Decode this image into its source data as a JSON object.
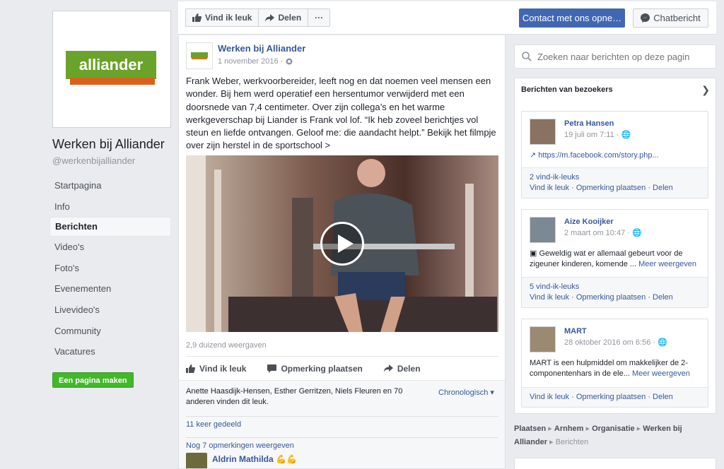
{
  "page": {
    "name": "Werken bij Alliander",
    "handle": "@werkenbijalliander",
    "logo_text": "alliander"
  },
  "nav": {
    "items": [
      {
        "label": "Startpagina"
      },
      {
        "label": "Info"
      },
      {
        "label": "Berichten",
        "active": true
      },
      {
        "label": "Video's"
      },
      {
        "label": "Foto's"
      },
      {
        "label": "Evenementen"
      },
      {
        "label": "Livevideo's"
      },
      {
        "label": "Community"
      },
      {
        "label": "Vacatures"
      }
    ],
    "create_page": "Een pagina maken"
  },
  "topbar": {
    "like": "Vind ik leuk",
    "share": "Delen",
    "more": "···",
    "contact": "Contact met ons opne…",
    "chat": "Chatbericht"
  },
  "post": {
    "author": "Werken bij Alliander",
    "date": "1 november 2016 · ",
    "text": "Frank Weber, werkvoorbereider, leeft nog en dat noemen veel mensen een wonder. Bij hem werd operatief een hersentumor verwijderd met een doorsnede van 7,4 centimeter. Over zijn collega’s en het warme werkgeverschap bij Liander is Frank vol lof. “Ik heb zoveel berichtjes vol steun en liefde ontvangen. Geloof me: die aandacht helpt.” Bekijk het filmpje over zijn herstel in de sportschool >",
    "views": "2,9 duizend weergaven",
    "actions": {
      "like": "Vind ik leuk",
      "comment": "Opmerking plaatsen",
      "share": "Delen"
    },
    "likes_text": "Anette Haasdijk-Hensen, Esther Gerritzen, Niels Fleuren en 70 anderen vinden dit leuk.",
    "sort": "Chronologisch ▾",
    "shared": "11 keer gedeeld",
    "more_comments": "Nog 7 opmerkingen weergeven",
    "comment_author": "Aldrin Mathilda 💪💪"
  },
  "search": {
    "placeholder": "Zoeken naar berichten op deze pagin"
  },
  "visitors": {
    "title": "Berichten van bezoekers",
    "cards": [
      {
        "name": "Petra Hansen",
        "time": "19 juli om 7:11 · 🌐",
        "body": "↗ https://m.facebook.com/story.php...",
        "likes": "2 vind-ik-leuks",
        "links": "Vind ik leuk · Opmerking plaatsen · Delen"
      },
      {
        "name": "Aize Kooijker",
        "time": "2 maart om 10:47 · 🌐",
        "body": "▣ Geweldig wat er allemaal gebeurt voor de zigeuner kinderen, komende ...",
        "more": "Meer weergeven",
        "likes": "5 vind-ik-leuks",
        "links": "Vind ik leuk · Opmerking plaatsen · Delen"
      },
      {
        "name": "MART",
        "time": "28 oktober 2016 om 6:56 · 🌐",
        "body": "MART is een hulpmiddel om makkelijker de 2-componentenhars in de ele...",
        "more": "Meer weergeven",
        "links": "Vind ik leuk · Opmerking plaatsen · Delen"
      }
    ]
  },
  "breadcrumb": {
    "p1": "Plaatsen",
    "p2": "Arnhem",
    "p3": "Organisatie",
    "p4": "Werken bij Alliander",
    "p5": "Berichten"
  },
  "colors": {
    "brand_blue": "#4267b2",
    "link": "#365899",
    "green": "#42b72a",
    "logo_green": "#6aa329",
    "logo_orange": "#e2731f"
  }
}
